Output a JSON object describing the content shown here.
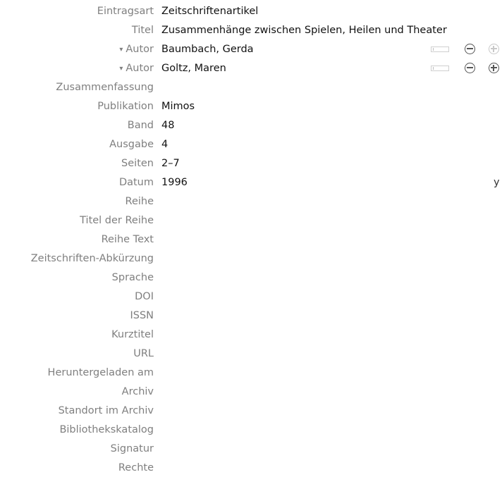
{
  "item_type": {
    "label": "Eintragsart",
    "value": "Zeitschriftenartikel"
  },
  "title": {
    "label": "Titel",
    "value": "Zusammenhänge zwischen Spielen, Heilen und Theater"
  },
  "creators": [
    {
      "label": "Autor",
      "value": "Baumbach, Gerda"
    },
    {
      "label": "Autor",
      "value": "Goltz, Maren"
    }
  ],
  "disclosure_glyph": "▾",
  "icons": {
    "creator_type_menu": "triangle-down-icon",
    "field_mode": "switch-field-mode-icon",
    "remove": "minus-circle-icon",
    "add": "plus-circle-icon"
  },
  "fields": [
    {
      "label": "Zusammenfassung",
      "value": ""
    },
    {
      "label": "Publikation",
      "value": "Mimos"
    },
    {
      "label": "Band",
      "value": "48"
    },
    {
      "label": "Ausgabe",
      "value": "4"
    },
    {
      "label": "Seiten",
      "value": "2–7"
    },
    {
      "label": "Datum",
      "value": "1996"
    },
    {
      "label": "Reihe",
      "value": ""
    },
    {
      "label": "Titel der Reihe",
      "value": ""
    },
    {
      "label": "Reihe Text",
      "value": ""
    },
    {
      "label": "Zeitschriften-Abkürzung",
      "value": ""
    },
    {
      "label": "Sprache",
      "value": ""
    },
    {
      "label": "DOI",
      "value": ""
    },
    {
      "label": "ISSN",
      "value": ""
    },
    {
      "label": "Kurztitel",
      "value": ""
    },
    {
      "label": "URL",
      "value": ""
    },
    {
      "label": "Heruntergeladen am",
      "value": ""
    },
    {
      "label": "Archiv",
      "value": ""
    },
    {
      "label": "Standort im Archiv",
      "value": ""
    },
    {
      "label": "Bibliothekskatalog",
      "value": ""
    },
    {
      "label": "Signatur",
      "value": ""
    },
    {
      "label": "Rechte",
      "value": ""
    }
  ],
  "date_format_hint": "y"
}
